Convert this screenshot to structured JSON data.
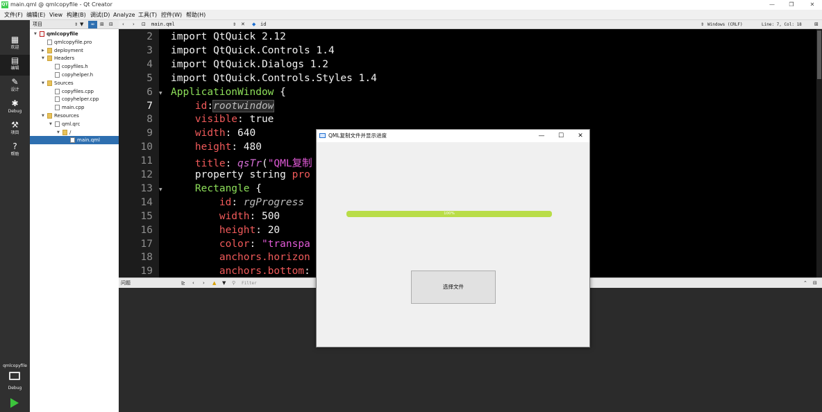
{
  "window": {
    "title": "main.qml @ qmlcopyfile - Qt Creator",
    "logo": "QT",
    "controls": [
      "—",
      "❐",
      "✕"
    ]
  },
  "menu": [
    "文件(F)",
    "编辑(E)",
    "View",
    "构建(B)",
    "调试(D)",
    "Analyze",
    "工具(T)",
    "控件(W)",
    "帮助(H)"
  ],
  "modes": [
    {
      "label": "欢迎",
      "icon": "grid-icon"
    },
    {
      "label": "编辑",
      "icon": "edit-doc-icon"
    },
    {
      "label": "设计",
      "icon": "pencil-icon"
    },
    {
      "label": "Debug",
      "icon": "bug-icon"
    },
    {
      "label": "项目",
      "icon": "wrench-icon"
    },
    {
      "label": "帮助",
      "icon": "help-icon"
    }
  ],
  "kit": {
    "project": "qmlcopyfile",
    "mode": "Debug"
  },
  "project_panel": {
    "header": "项目",
    "tree": [
      {
        "label": "qmlcopyfile",
        "level": 0,
        "bold": true,
        "expanded": true,
        "kind": "project"
      },
      {
        "label": "qmlcopyfile.pro",
        "level": 1,
        "kind": "file"
      },
      {
        "label": "deployment",
        "level": 1,
        "kind": "folder-qt",
        "expanded": false
      },
      {
        "label": "Headers",
        "level": 1,
        "kind": "folder",
        "expanded": true
      },
      {
        "label": "copyfiles.h",
        "level": 2,
        "kind": "file"
      },
      {
        "label": "copyhelper.h",
        "level": 2,
        "kind": "file"
      },
      {
        "label": "Sources",
        "level": 1,
        "kind": "folder",
        "expanded": true
      },
      {
        "label": "copyfiles.cpp",
        "level": 2,
        "kind": "file"
      },
      {
        "label": "copyhelper.cpp",
        "level": 2,
        "kind": "file"
      },
      {
        "label": "main.cpp",
        "level": 2,
        "kind": "file"
      },
      {
        "label": "Resources",
        "level": 1,
        "kind": "folder",
        "expanded": true
      },
      {
        "label": "qml.qrc",
        "level": 2,
        "kind": "file",
        "expanded": true
      },
      {
        "label": "/",
        "level": 3,
        "kind": "folder",
        "expanded": true
      },
      {
        "label": "main.qml",
        "level": 4,
        "kind": "file",
        "selected": true
      }
    ]
  },
  "editor_toolbar": {
    "file": "main.qml",
    "symbol": "id",
    "encoding": "Windows (CRLF)",
    "position": "Line: 7, Col: 18"
  },
  "code": {
    "lines": [
      {
        "n": "2",
        "fold": false,
        "parts": [
          [
            "kw",
            "import "
          ],
          [
            "kw",
            "QtQuick 2.12"
          ]
        ]
      },
      {
        "n": "3",
        "fold": false,
        "parts": [
          [
            "kw",
            "import "
          ],
          [
            "kw",
            "QtQuick.Controls 1.4"
          ]
        ]
      },
      {
        "n": "4",
        "fold": false,
        "parts": [
          [
            "kw",
            "import "
          ],
          [
            "kw",
            "QtQuick.Dialogs 1.2"
          ]
        ]
      },
      {
        "n": "5",
        "fold": false,
        "parts": [
          [
            "kw",
            "import "
          ],
          [
            "kw",
            "QtQuick.Controls.Styles 1.4"
          ]
        ]
      },
      {
        "n": "6",
        "fold": true,
        "parts": [
          [
            "type",
            "ApplicationWindow"
          ],
          [
            "kw",
            " {"
          ]
        ]
      },
      {
        "n": "7",
        "fold": false,
        "current": true,
        "parts": [
          [
            "kw",
            "    "
          ],
          [
            "prop",
            "id"
          ],
          [
            "kw",
            ":"
          ],
          [
            "id",
            "rootwindow"
          ]
        ]
      },
      {
        "n": "8",
        "fold": false,
        "parts": [
          [
            "kw",
            "    "
          ],
          [
            "prop",
            "visible"
          ],
          [
            "kw",
            ": true"
          ]
        ]
      },
      {
        "n": "9",
        "fold": false,
        "parts": [
          [
            "kw",
            "    "
          ],
          [
            "prop",
            "width"
          ],
          [
            "kw",
            ": 640"
          ]
        ]
      },
      {
        "n": "10",
        "fold": false,
        "parts": [
          [
            "kw",
            "    "
          ],
          [
            "prop",
            "height"
          ],
          [
            "kw",
            ": 480"
          ]
        ]
      },
      {
        "n": "11",
        "fold": false,
        "parts": [
          [
            "kw",
            "    "
          ],
          [
            "prop",
            "title"
          ],
          [
            "kw",
            ": "
          ],
          [
            "fn",
            "qsTr"
          ],
          [
            "kw",
            "("
          ],
          [
            "str",
            "\"QML复制"
          ]
        ]
      },
      {
        "n": "12",
        "fold": false,
        "parts": [
          [
            "kw",
            "    property string "
          ],
          [
            "prop",
            "pro"
          ]
        ]
      },
      {
        "n": "13",
        "fold": true,
        "parts": [
          [
            "kw",
            "    "
          ],
          [
            "type",
            "Rectangle"
          ],
          [
            "kw",
            " {"
          ]
        ]
      },
      {
        "n": "14",
        "fold": false,
        "parts": [
          [
            "kw",
            "        "
          ],
          [
            "prop",
            "id"
          ],
          [
            "kw",
            ": "
          ],
          [
            "id",
            "rgProgress"
          ]
        ]
      },
      {
        "n": "15",
        "fold": false,
        "parts": [
          [
            "kw",
            "        "
          ],
          [
            "prop",
            "width"
          ],
          [
            "kw",
            ": 500"
          ]
        ]
      },
      {
        "n": "16",
        "fold": false,
        "parts": [
          [
            "kw",
            "        "
          ],
          [
            "prop",
            "height"
          ],
          [
            "kw",
            ": 20"
          ]
        ]
      },
      {
        "n": "17",
        "fold": false,
        "parts": [
          [
            "kw",
            "        "
          ],
          [
            "prop",
            "color"
          ],
          [
            "kw",
            ": "
          ],
          [
            "str",
            "\"transpa"
          ]
        ]
      },
      {
        "n": "18",
        "fold": false,
        "parts": [
          [
            "kw",
            "        "
          ],
          [
            "prop",
            "anchors.horizon"
          ]
        ]
      },
      {
        "n": "19",
        "fold": false,
        "parts": [
          [
            "kw",
            "        "
          ],
          [
            "prop",
            "anchors.bottom"
          ],
          [
            "kw",
            ":"
          ]
        ]
      }
    ]
  },
  "issues": {
    "title": "问题",
    "filter_placeholder": "Filter"
  },
  "qml_window": {
    "title": "QML复制文件并显示进度",
    "controls": [
      "—",
      "☐",
      "✕"
    ],
    "progress_percent": 100,
    "progress_text": "100%",
    "progress_color": "#b9dd48",
    "button_label": "选择文件"
  }
}
